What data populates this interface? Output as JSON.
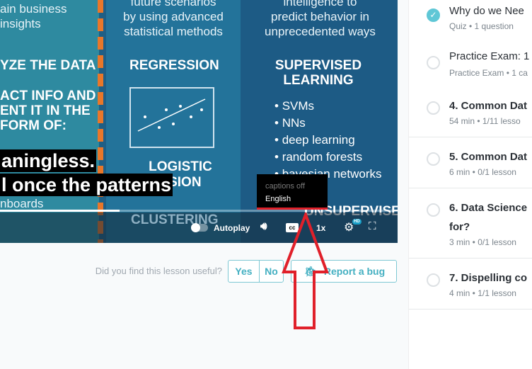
{
  "video": {
    "slide": {
      "left_top": [
        "ain business",
        "insights"
      ],
      "left_heading": "YZE THE DATA",
      "left_body": [
        "ACT INFO AND",
        "ENT IT IN THE",
        "FORM OF:"
      ],
      "left_bottom": "nboards",
      "mid_top": [
        "future scenarios",
        "by using advanced",
        "statistical methods"
      ],
      "regression": "REGRESSION",
      "logistic": [
        "LOGISTIC",
        "SSION"
      ],
      "clustering": "CLUSTERING",
      "right_top": [
        "intelligence to",
        "predict behavior in",
        "unprecedented ways"
      ],
      "supervised": [
        "SUPERVISED",
        "LEARNING"
      ],
      "supervised_items": [
        "SVMs",
        "NNs",
        "deep learning",
        "random forests",
        "bayesian networks"
      ],
      "unsupervised": "UNSUPERVISED"
    },
    "captions": [
      "aningless.",
      "l once the patterns"
    ],
    "progress_percent": 30,
    "controls": {
      "autoplay_label": "Autoplay",
      "autoplay_on": false,
      "cc_label": "cc",
      "speed": "1x",
      "hd_badge": "HD"
    },
    "caption_menu": {
      "options": [
        "captions off",
        "English"
      ],
      "selected": "English"
    }
  },
  "feedback": {
    "question": "Did you find this lesson useful?",
    "yes": "Yes",
    "no": "No",
    "report_bug": "Report a bug"
  },
  "annotation_color": "#e0202a",
  "accent_color": "#5fc7d6",
  "sidebar": {
    "items": [
      {
        "title": "Why do we Nee",
        "meta": "Quiz  •  1 question",
        "completed": true
      },
      {
        "title": "Practice Exam: 1",
        "meta": "Practice Exam  •  1 ca",
        "completed": false
      },
      {
        "title": "4. Common Dat",
        "meta": "54 min  •  1/11 lesso",
        "completed": false
      },
      {
        "title": "5. Common Dat",
        "meta": "6 min  •  0/1 lesson",
        "completed": false
      },
      {
        "title": "6. Data Science",
        "title2": "for?",
        "meta": "3 min  •  0/1 lesson",
        "completed": false
      },
      {
        "title": "7. Dispelling co",
        "meta": "4 min  •  1/1 lesson",
        "completed": false
      }
    ]
  }
}
